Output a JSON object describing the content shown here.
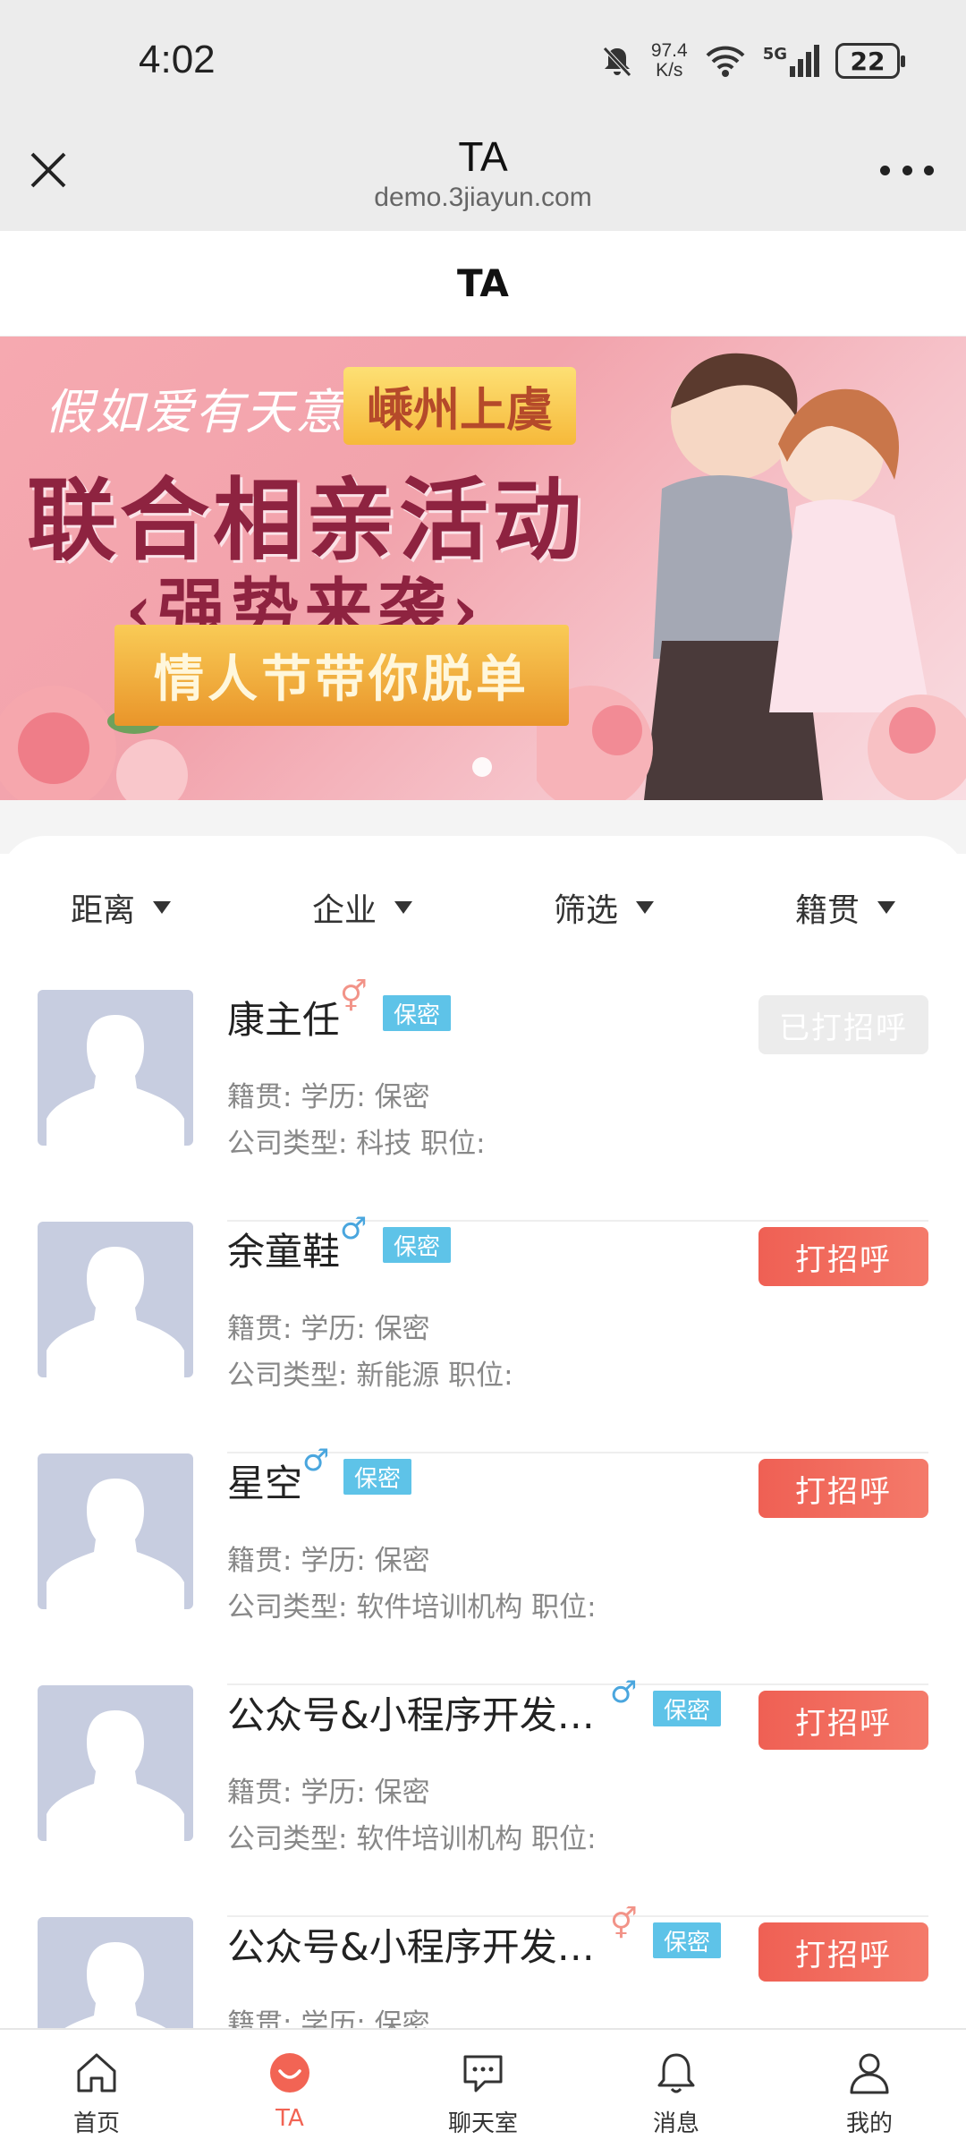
{
  "status_bar": {
    "time": "4:02",
    "net_speed_value": "97.4",
    "net_speed_unit": "K/s",
    "network": "5G",
    "battery": "22"
  },
  "title_bar": {
    "title": "TA",
    "url": "demo.3jiayun.com"
  },
  "page_header": {
    "title": "TA"
  },
  "banner": {
    "line1": "假如爱有天意、",
    "tag": "嵊州上虞",
    "line2": "联合相亲活动",
    "line3": "‹强势来袭›",
    "ribbon": "情人节带你脱单"
  },
  "filters": [
    {
      "label": "距离"
    },
    {
      "label": "企业"
    },
    {
      "label": "筛选"
    },
    {
      "label": "籍贯"
    }
  ],
  "users": [
    {
      "name": "康主任",
      "gender": "female",
      "gender_symbol": "⚥",
      "privacy": "保密",
      "line1": "籍贯:        学历: 保密",
      "line2": "公司类型: 科技     职位:",
      "action": "已打招呼",
      "greeted": true
    },
    {
      "name": "余童鞋",
      "gender": "male",
      "gender_symbol": "♂",
      "privacy": "保密",
      "line1": "籍贯:        学历: 保密",
      "line2": "公司类型: 新能源     职位:",
      "action": "打招呼",
      "greeted": false
    },
    {
      "name": "星空",
      "gender": "male",
      "gender_symbol": "♂",
      "privacy": "保密",
      "line1": "籍贯:        学历: 保密",
      "line2": "公司类型: 软件培训机构     职位:",
      "action": "打招呼",
      "greeted": false
    },
    {
      "name": "公众号&小程序开发…",
      "gender": "male",
      "gender_symbol": "♂",
      "privacy": "保密",
      "line1": "籍贯:        学历: 保密",
      "line2": "公司类型: 软件培训机构     职位:",
      "action": "打招呼",
      "greeted": false
    },
    {
      "name": "公众号&小程序开发…",
      "gender": "female",
      "gender_symbol": "⚥",
      "privacy": "保密",
      "line1": "籍贯:        学历: 保密",
      "line2": "",
      "action": "打招呼",
      "greeted": false
    }
  ],
  "bottom_nav": [
    {
      "label": "首页",
      "icon": "home-icon",
      "active": false
    },
    {
      "label": "TA",
      "icon": "smile-icon",
      "active": true
    },
    {
      "label": "聊天室",
      "icon": "chat-icon",
      "active": false
    },
    {
      "label": "消息",
      "icon": "bell-icon",
      "active": false
    },
    {
      "label": "我的",
      "icon": "user-icon",
      "active": false
    }
  ],
  "colors": {
    "accent": "#f26454",
    "privacy_badge": "#5ec3e8",
    "male": "#4aa6de",
    "female": "#f29388",
    "avatar_placeholder": "#c7cde0"
  }
}
